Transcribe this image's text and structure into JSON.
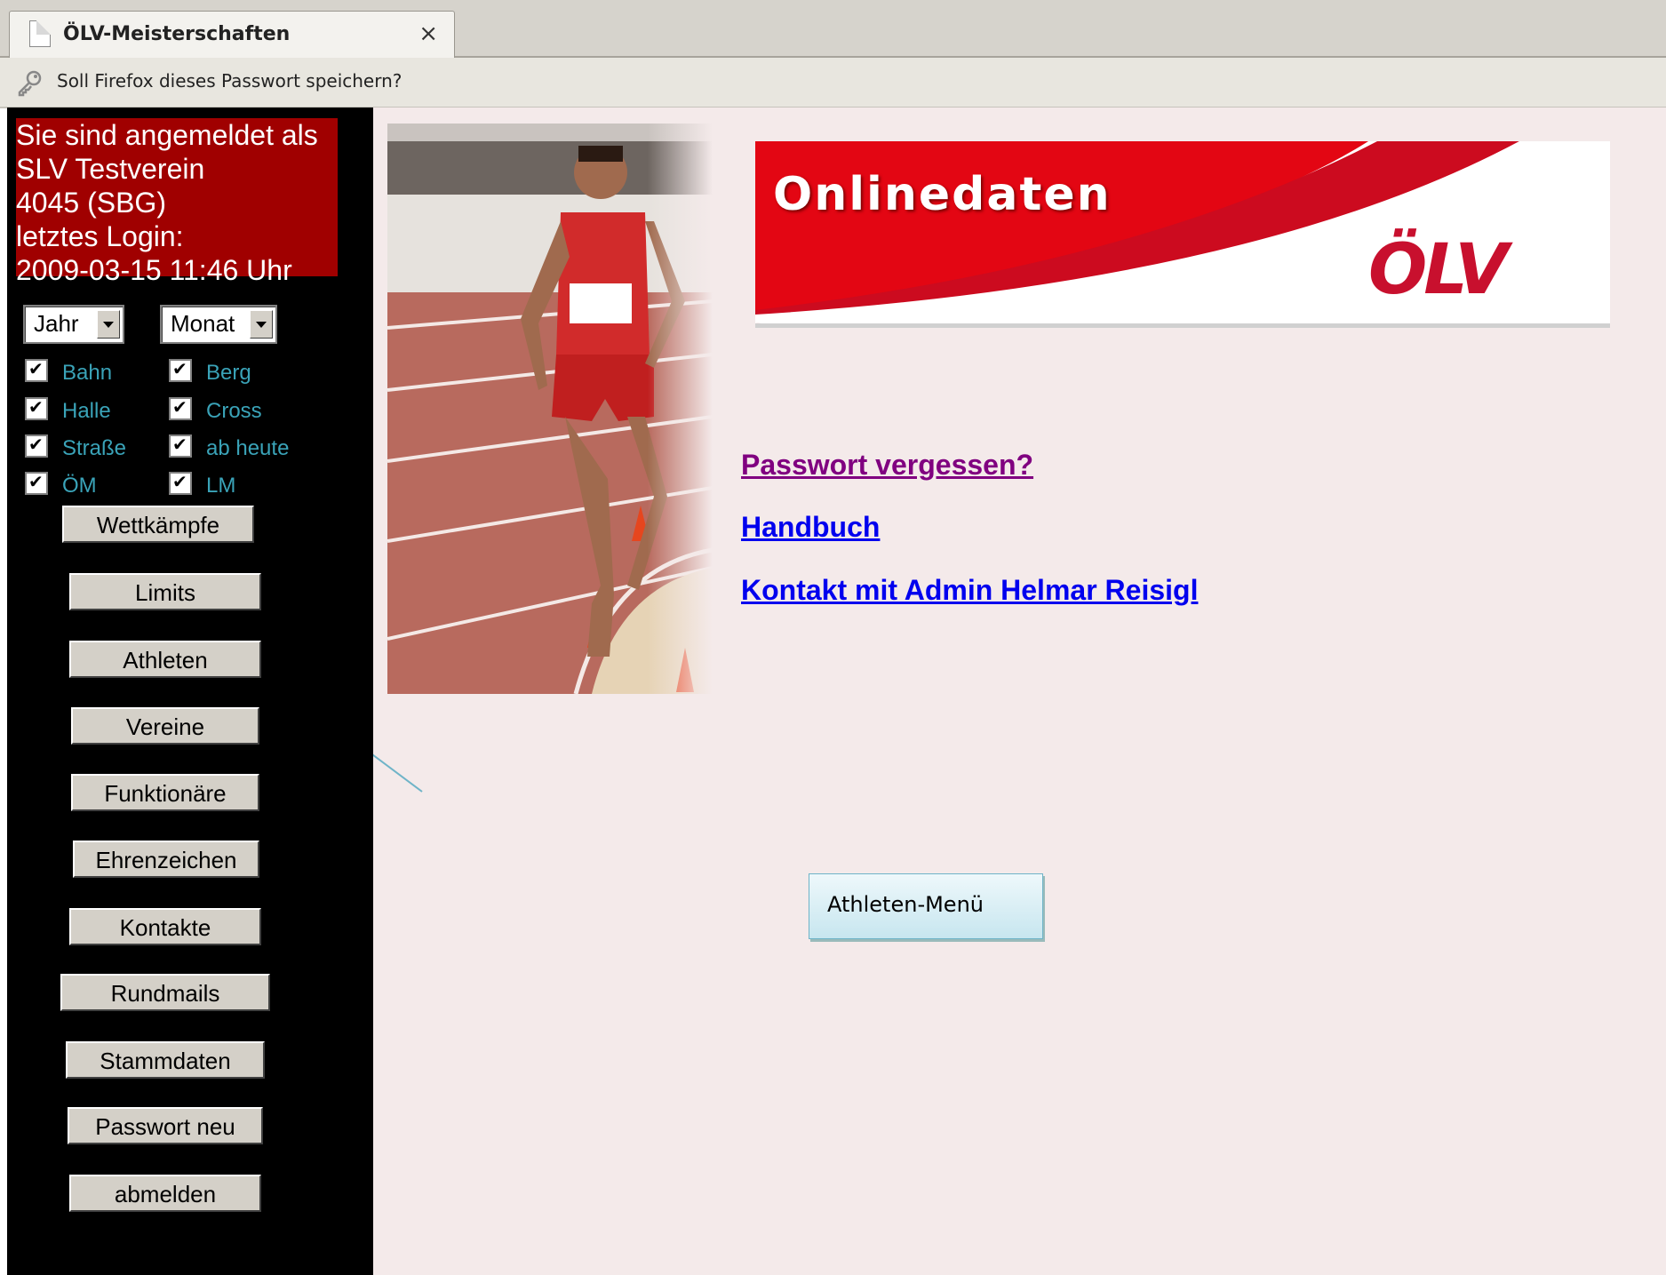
{
  "browser": {
    "tab_title": "ÖLV-Meisterschaften",
    "tab_close": "×",
    "notification": "Soll Firefox dieses Passwort speichern?"
  },
  "sidebar": {
    "login": {
      "line1": "Sie sind angemeldet als",
      "line2": "SLV Testverein",
      "line3": "4045 (SBG)",
      "line4": "letztes Login:",
      "line5": "2009-03-15 11:46 Uhr"
    },
    "selects": {
      "year": "Jahr",
      "month": "Monat"
    },
    "filters": [
      {
        "label": "Bahn",
        "checked": true
      },
      {
        "label": "Berg",
        "checked": true
      },
      {
        "label": "Halle",
        "checked": true
      },
      {
        "label": "Cross",
        "checked": true
      },
      {
        "label": "Straße",
        "checked": true
      },
      {
        "label": "ab heute",
        "checked": true
      },
      {
        "label": "ÖM",
        "checked": true
      },
      {
        "label": "LM",
        "checked": true
      }
    ],
    "menu": [
      "Wettkämpfe",
      "Limits",
      "Athleten",
      "Vereine",
      "Funktionäre",
      "Ehrenzeichen",
      "Kontakte",
      "Rundmails",
      "Stammdaten",
      "Passwort neu",
      "abmelden"
    ]
  },
  "main": {
    "banner_title": "Onlinedaten",
    "banner_logo": "ÖLV",
    "links": {
      "forgot_password": "Passwort vergessen?",
      "manual": "Handbuch",
      "contact_admin": "Kontakt mit Admin Helmar Reisigl"
    },
    "link_colors": {
      "visited": "#800080",
      "unvisited": "#0000ee"
    },
    "callout": "Athleten-Menü"
  },
  "colors": {
    "sidebar_bg": "#000000",
    "login_bg": "#a00000",
    "filter_label": "#3aa3b8",
    "content_bg": "#f4eaea"
  }
}
